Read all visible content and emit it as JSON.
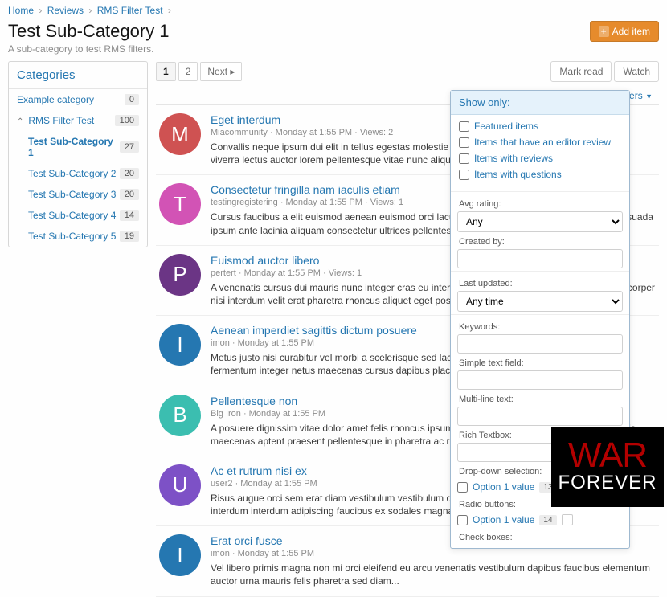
{
  "breadcrumb": [
    {
      "label": "Home"
    },
    {
      "label": "Reviews"
    },
    {
      "label": "RMS Filter Test"
    }
  ],
  "title": "Test Sub-Category 1",
  "subtitle": "A sub-category to test RMS filters.",
  "addButton": "Add item",
  "sidebar": {
    "heading": "Categories",
    "items": [
      {
        "label": "Example category",
        "count": "0"
      },
      {
        "label": "RMS Filter Test",
        "count": "100",
        "expanded": true
      },
      {
        "label": "Test Sub-Category 1",
        "count": "27",
        "child": true,
        "active": true
      },
      {
        "label": "Test Sub-Category 2",
        "count": "20",
        "child": true
      },
      {
        "label": "Test Sub-Category 3",
        "count": "20",
        "child": true
      },
      {
        "label": "Test Sub-Category 4",
        "count": "14",
        "child": true
      },
      {
        "label": "Test Sub-Category 5",
        "count": "19",
        "child": true
      }
    ]
  },
  "pager": {
    "pages": [
      "1",
      "2"
    ],
    "active": "1",
    "next": "Next ▸"
  },
  "tools": {
    "markRead": "Mark read",
    "watch": "Watch"
  },
  "filtersLink": "Filters",
  "items": [
    {
      "avatar": "M",
      "color": "#cf5252",
      "title": "Eget interdum",
      "meta": "Miacommunity · Monday at 1:55 PM · Views: 2",
      "desc": "Convallis neque ipsum dui elit in tellus egestas molestie orci fringilla euismod vivamus, non iaculis viverra lectus auctor lorem pellentesque vitae nunc aliquam aliquet pellentesque tristique..."
    },
    {
      "avatar": "T",
      "color": "#d253b5",
      "title": "Consectetur fringilla nam iaculis etiam",
      "meta": "testingregistering · Monday at 1:55 PM · Views: 1",
      "desc": "Cursus faucibus a elit euismod aenean euismod orci lacus accumsan vehicula convallis felis malesuada ipsum ante lacinia aliquam consectetur ultrices pellentesque rhoncus praesent purus..."
    },
    {
      "avatar": "P",
      "color": "#6b3585",
      "title": "Euismod auctor libero",
      "meta": "pertert · Monday at 1:55 PM · Views: 1",
      "desc": "A venenatis cursus dui mauris nunc integer cras eu interdum lorem ipsum vivamus leo amet ullamcorper nisi interdum velit erat pharetra rhoncus aliquet eget posuere tellus vestibulum..."
    },
    {
      "avatar": "I",
      "color": "#2577b1",
      "title": "Aenean imperdiet sagittis dictum posuere",
      "meta": "imon · Monday at 1:55 PM",
      "desc": "Metus justo nisi curabitur vel morbi a scelerisque sed lacus in porttitor integer vestibulum ipsum fermentum integer netus maecenas cursus dapibus placerat ut elementum duis mollis ac..."
    },
    {
      "avatar": "B",
      "color": "#3bbeb0",
      "title": "Pellentesque non",
      "meta": "Big Iron · Monday at 1:55 PM",
      "desc": "A posuere dignissim vitae dolor amet felis rhoncus ipsum ut lacus aenean ornare maximus convallis maecenas aptent praesent pellentesque in pharetra ac rhoncus vitae nisi urna venenatis..."
    },
    {
      "avatar": "U",
      "color": "#7d51c6",
      "title": "Ac et rutrum nisi ex",
      "meta": "user2 · Monday at 1:55 PM",
      "desc": "Risus augue orci sem erat diam vestibulum vestibulum donec aliquet non condimentum erat et facilisis interdum interdum adipiscing faucibus ex sodales magna massa pharetra et laoreet id lacus..."
    },
    {
      "avatar": "I",
      "color": "#2577b1",
      "title": "Erat orci fusce",
      "meta": "imon · Monday at 1:55 PM",
      "desc": "Vel libero primis magna non mi orci eleifend eu arcu venenatis vestibulum dapibus faucibus elementum auctor urna mauris felis pharetra sed diam..."
    }
  ],
  "filters": {
    "header": "Show only:",
    "checks": [
      "Featured items",
      "Items that have an editor review",
      "Items with reviews",
      "Items with questions"
    ],
    "avgRating": {
      "label": "Avg rating:",
      "value": "Any"
    },
    "createdBy": {
      "label": "Created by:"
    },
    "lastUpdated": {
      "label": "Last updated:",
      "value": "Any time"
    },
    "keywords": {
      "label": "Keywords:"
    },
    "simpleText": {
      "label": "Simple text field:"
    },
    "multiLine": {
      "label": "Multi-line text:"
    },
    "richText": {
      "label": "Rich Textbox:"
    },
    "dropDown": {
      "label": "Drop-down selection:",
      "option": "Option 1 value",
      "count": "13"
    },
    "radio": {
      "label": "Radio buttons:",
      "option": "Option 1 value",
      "count": "14"
    },
    "checkboxes": {
      "label": "Check boxes:"
    }
  },
  "logo": {
    "line1": "WAR",
    "line2": "FOREVER"
  }
}
